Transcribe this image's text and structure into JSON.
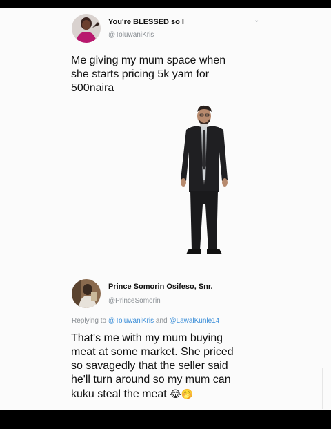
{
  "tweet1": {
    "display_name": "You're BLESSED so I",
    "handle": "@ToluwaniKris",
    "text_lines": [
      "Me giving my mum space when",
      "she starts pricing 5k yam for",
      "500naira"
    ],
    "menu_icon": "chevron-down-icon"
  },
  "tweet2": {
    "display_name": "Prince Somorin Osifeso, Snr.",
    "handle": "@PrinceSomorin",
    "replying_prefix": "Replying to",
    "replying_user1": "@ToluwaniKris",
    "replying_and": "and",
    "replying_user2": "@LawalKunle14",
    "text_lines": [
      "That's me with my mum buying",
      "meat at some market. She priced",
      "so savagedly that the seller said",
      "he'll turn around so my mum can",
      "kuku steal the meat"
    ],
    "emojis": "😂🤭"
  }
}
